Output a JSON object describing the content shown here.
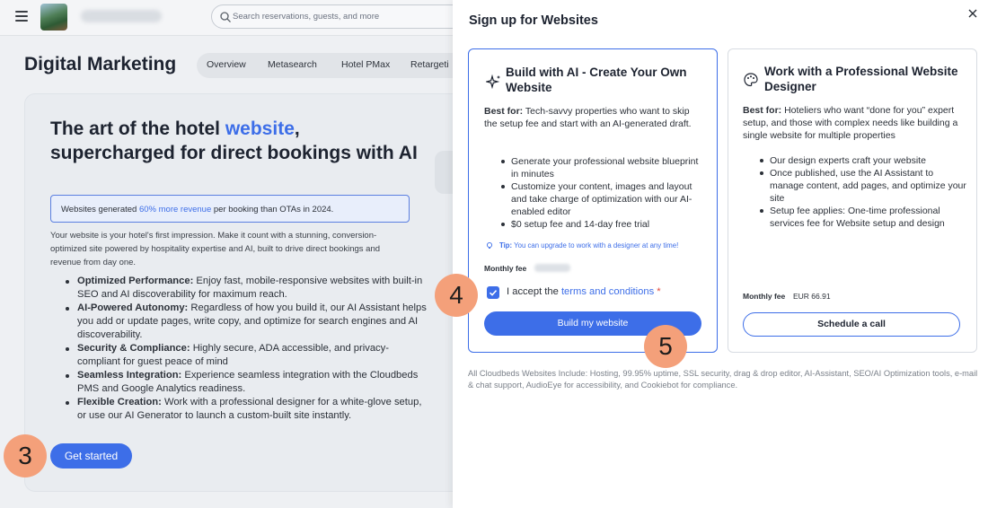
{
  "topbar": {
    "search_placeholder": "Search reservations, guests, and more"
  },
  "page": {
    "title": "Digital Marketing",
    "tabs": [
      {
        "label": "Overview"
      },
      {
        "label": "Metasearch"
      },
      {
        "label": "Hotel PMax"
      },
      {
        "label": "Retargeti"
      }
    ]
  },
  "hero": {
    "title_part1": "The art of the hotel ",
    "title_accent": "website",
    "title_part2": ", supercharged for direct bookings with AI",
    "stat_prefix": "Websites generated ",
    "stat_link": "60% more revenue",
    "stat_suffix": " per booking than OTAs in 2024.",
    "description": "Your website is your hotel's first impression. Make it count with a stunning, conversion-optimized site powered by hospitality expertise and AI, built to drive direct bookings and revenue from day one.",
    "features": [
      {
        "title": "Optimized Performance:",
        "text": " Enjoy fast, mobile-responsive websites with built-in SEO and AI discoverability for maximum reach."
      },
      {
        "title": "AI-Powered Autonomy:",
        "text": " Regardless of how you build it, our AI Assistant helps you add or update pages, write copy, and optimize for search engines and AI discoverability."
      },
      {
        "title": "Security & Compliance:",
        "text": " Highly secure, ADA accessible, and privacy-compliant for guest peace of mind"
      },
      {
        "title": "Seamless Integration:",
        "text": " Experience seamless integration with the Cloudbeds PMS and Google Analytics readiness."
      },
      {
        "title": "Flexible Creation:",
        "text": " Work with a professional designer for a white-glove setup, or use our AI Generator to launch a custom-built site instantly."
      }
    ],
    "cta_label": "Get started"
  },
  "badges": {
    "step3": "3",
    "step4": "4",
    "step5": "5"
  },
  "drawer": {
    "title": "Sign up for Websites",
    "ai_card": {
      "title": "Build with AI - Create Your Own Website",
      "best_for_label": "Best for:",
      "best_for_text": " Tech-savvy properties who want to skip the setup fee and start with an AI-generated draft.",
      "bullets": [
        "Generate your professional website blueprint in minutes",
        "Customize your content, images and layout and take charge of optimization with our AI-enabled editor",
        "$0 setup fee and 14-day free trial"
      ],
      "tip_label": "Tip:",
      "tip_text": " You can upgrade to work with a designer at any time!",
      "fee_label": "Monthly fee",
      "accept_prefix": "I accept the ",
      "accept_link": "terms and conditions",
      "accept_required": "*",
      "button_label": "Build my website"
    },
    "pro_card": {
      "title": "Work with a Professional Website Designer",
      "best_for_label": "Best for:",
      "best_for_text": " Hoteliers who want “done for you” expert setup, and those with complex needs like building a single website for multiple properties",
      "bullets": [
        "Our design experts craft your website",
        "Once published, use the AI Assistant to manage content, add pages, and optimize your site",
        "Setup fee applies: One-time professional services fee for Website setup and design"
      ],
      "fee_label": "Monthly fee",
      "fee_value": "EUR 66.91",
      "button_label": "Schedule a call"
    },
    "footnote": "All Cloudbeds Websites Include: Hosting, 99.95% uptime, SSL security, drag & drop editor, AI-Assistant, SEO/AI Optimization tools, e-mail & chat support, AudioEye for accessibility, and Cookiebot for compliance."
  },
  "colors": {
    "accent": "#3d6ee8",
    "badge": "#f4a07a",
    "required": "#e0463a"
  }
}
